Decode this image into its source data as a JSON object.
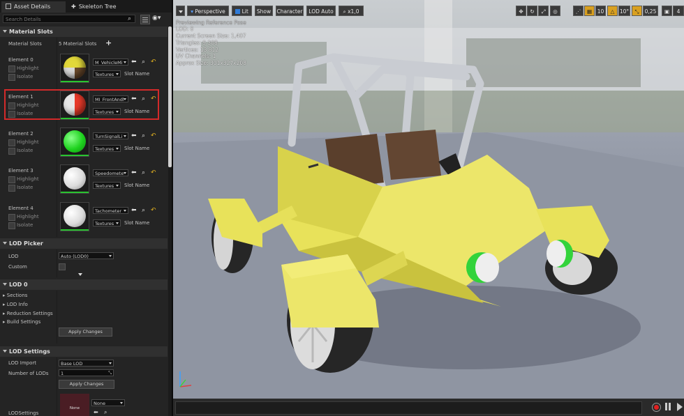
{
  "tabs": [
    {
      "label": "Asset Details"
    },
    {
      "label": "Skeleton Tree"
    }
  ],
  "search": {
    "placeholder": "Search Details"
  },
  "material_slots": {
    "section_label": "Material Slots",
    "label": "Material Slots",
    "count_text": "5 Material Slots",
    "elements": [
      {
        "label": "Element 0",
        "material": "M_VehicleMi",
        "textures_label": "Textures",
        "slot_name_label": "Slot Name",
        "highlight_label": "Highlight",
        "isolate_label": "Isolate"
      },
      {
        "label": "Element 1",
        "material": "MI_FrontAndl",
        "textures_label": "Textures",
        "slot_name_label": "Slot Name",
        "highlight_label": "Highlight",
        "isolate_label": "Isolate"
      },
      {
        "label": "Element 2",
        "material": "TurnSignalLi",
        "textures_label": "Textures",
        "slot_name_label": "Slot Name",
        "highlight_label": "Highlight",
        "isolate_label": "Isolate"
      },
      {
        "label": "Element 3",
        "material": "Speedomete",
        "textures_label": "Textures",
        "slot_name_label": "Slot Name",
        "highlight_label": "Highlight",
        "isolate_label": "Isolate"
      },
      {
        "label": "Element 4",
        "material": "Tachometer",
        "textures_label": "Textures",
        "slot_name_label": "Slot Name",
        "highlight_label": "Highlight",
        "isolate_label": "Isolate"
      }
    ]
  },
  "lod_picker": {
    "section_label": "LOD Picker",
    "lod_label": "LOD",
    "lod_value": "Auto (LOD0)",
    "custom_label": "Custom"
  },
  "lod0": {
    "section_label": "LOD 0",
    "items": [
      {
        "label": "Sections"
      },
      {
        "label": "LOD Info"
      },
      {
        "label": "Reduction Settings"
      },
      {
        "label": "Build Settings"
      }
    ],
    "apply_label": "Apply Changes"
  },
  "lod_settings": {
    "section_label": "LOD Settings",
    "import_label": "LOD Import",
    "import_value": "Base LOD",
    "num_lods_label": "Number of LODs",
    "num_lods_value": "1",
    "apply_label": "Apply Changes",
    "lod_settings_label": "LODSettings",
    "none_thumb": "None",
    "none_dd": "None"
  },
  "viewport": {
    "toolbar": {
      "perspective": "Perspective",
      "lit": "Lit",
      "show": "Show",
      "character": "Character",
      "lod_auto": "LOD Auto",
      "speed": "x1,0",
      "grid_value": "10",
      "angle_value": "10°",
      "scale_value": "0,25",
      "camera_value": "4"
    },
    "stats": [
      "Previewing Reference Pose",
      "LOD: 0",
      "Current Screen Size: 1,407",
      "Triangles: 9 308",
      "Vertices: 13 812",
      "UV Channels: 1",
      "Approx Size: 301x327x208"
    ]
  },
  "colors": {
    "highlight_border": "#d42a2a",
    "green_bar": "#29c52f",
    "car_yellow": "#e8e25a",
    "accent_blue": "#2f7bd8"
  },
  "icons": [
    "grid-view-icon",
    "eye-icon",
    "search-icon",
    "plus-icon",
    "use-selected-arrow-icon",
    "browse-icon",
    "reset-arrow-icon",
    "axis-gizmo-icon",
    "record-icon",
    "pause-icon",
    "play-icon"
  ]
}
